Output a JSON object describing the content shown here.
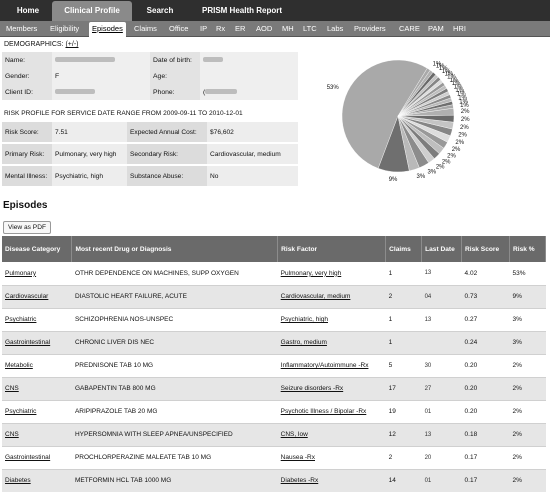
{
  "top_nav": [
    "Home",
    "Clinical Profile",
    "Search",
    "PRISM Health Report"
  ],
  "sub_nav": [
    "Members",
    "Eligibility",
    "Episodes",
    "Claims",
    "Office",
    "IP",
    "Rx",
    "ER",
    "AOD",
    "MH",
    "LTC",
    "Labs",
    "Providers",
    "CARE",
    "PAM",
    "HRI"
  ],
  "demographics": {
    "heading": "DEMOGRAPHICS:",
    "toggle": "(+/-)",
    "name_label": "Name:",
    "dob_label": "Date of birth:",
    "gender_label": "Gender:",
    "gender_value": "F",
    "age_label": "Age:",
    "client_id_label": "Client ID:",
    "phone_label": "Phone:",
    "phone_value": "("
  },
  "risk_profile": {
    "heading": "RISK PROFILE FOR SERVICE DATE RANGE FROM 2009-09-11 TO 2010-12-01",
    "risk_score_label": "Risk Score:",
    "risk_score_value": "7.51",
    "expected_cost_label": "Expected Annual Cost:",
    "expected_cost_value": "$76,602",
    "primary_label": "Primary Risk:",
    "primary_value": "Pulmonary, very high",
    "secondary_label": "Secondary Risk:",
    "secondary_value": "Cardiovascular, medium",
    "mental_label": "Mental Illness:",
    "mental_value": "Psychiatric, high",
    "substance_label": "Substance Abuse:",
    "substance_value": "No"
  },
  "chart_data": {
    "type": "pie",
    "title": "",
    "slices": [
      {
        "label": "53%",
        "value": 53
      },
      {
        "label": "9%",
        "value": 9
      },
      {
        "label": "3%",
        "value": 3
      },
      {
        "label": "3%",
        "value": 3
      },
      {
        "label": "2%",
        "value": 2
      },
      {
        "label": "2%",
        "value": 2
      },
      {
        "label": "2%",
        "value": 2
      },
      {
        "label": "2%",
        "value": 2
      },
      {
        "label": "2%",
        "value": 2
      },
      {
        "label": "2%",
        "value": 2
      },
      {
        "label": "2%",
        "value": 2
      },
      {
        "label": "2%",
        "value": 2
      },
      {
        "label": "2%",
        "value": 2
      },
      {
        "label": "1%",
        "value": 1
      },
      {
        "label": "1%",
        "value": 1
      },
      {
        "label": "1%",
        "value": 1
      },
      {
        "label": "1%",
        "value": 1
      },
      {
        "label": "1%",
        "value": 1
      },
      {
        "label": "1%",
        "value": 1
      },
      {
        "label": "1%",
        "value": 1
      },
      {
        "label": "1%",
        "value": 1
      },
      {
        "label": "1%",
        "value": 1
      },
      {
        "label": "1%",
        "value": 1
      },
      {
        "label": "1%",
        "value": 1
      },
      {
        "label": "1%",
        "value": 1
      },
      {
        "label": "1%",
        "value": 1
      },
      {
        "label": "1%",
        "value": 1
      }
    ]
  },
  "episodes": {
    "title": "Episodes",
    "pdf_button": "View as PDF",
    "columns": [
      "Disease Category",
      "Most recent Drug or Diagnosis",
      "Risk Factor",
      "Claims",
      "Last Date",
      "Risk Score",
      "Risk %"
    ],
    "rows": [
      {
        "category": "Pulmonary",
        "drug": "OTHR DEPENDENCE ON MACHINES, SUPP OXYGEN",
        "factor": "Pulmonary, very high",
        "claims": "1",
        "date": "13",
        "score": "4.02",
        "pct": "53%"
      },
      {
        "category": "Cardiovascular",
        "drug": "DIASTOLIC HEART FAILURE, ACUTE",
        "factor": "Cardiovascular, medium",
        "claims": "2",
        "date": "04",
        "score": "0.73",
        "pct": "9%"
      },
      {
        "category": "Psychiatric",
        "drug": "SCHIZOPHRENIA NOS-UNSPEC",
        "factor": "Psychiatric, high",
        "claims": "1",
        "date": "13",
        "score": "0.27",
        "pct": "3%"
      },
      {
        "category": "Gastrointestinal",
        "drug": "CHRONIC LIVER DIS NEC",
        "factor": "Gastro, medium",
        "claims": "1",
        "date": "",
        "score": "0.24",
        "pct": "3%"
      },
      {
        "category": "Metabolic",
        "drug": "PREDNISONE TAB 10 MG",
        "factor": "Inflammatory/Autoimmune -Rx",
        "claims": "5",
        "date": "30",
        "score": "0.20",
        "pct": "2%"
      },
      {
        "category": "CNS",
        "drug": "GABAPENTIN TAB 800 MG",
        "factor": "Seizure disorders -Rx",
        "claims": "17",
        "date": "27",
        "score": "0.20",
        "pct": "2%"
      },
      {
        "category": "Psychiatric",
        "drug": "ARIPIPRAZOLE TAB 20 MG",
        "factor": "Psychotic Illness / Bipolar -Rx",
        "claims": "19",
        "date": "01",
        "score": "0.20",
        "pct": "2%"
      },
      {
        "category": "CNS",
        "drug": "HYPERSOMNIA WITH SLEEP APNEA/UNSPECIFIED",
        "factor": "CNS, low",
        "claims": "12",
        "date": "13",
        "score": "0.18",
        "pct": "2%"
      },
      {
        "category": "Gastrointestinal",
        "drug": "PROCHLORPERAZINE MALEATE TAB 10 MG",
        "factor": "Nausea -Rx",
        "claims": "2",
        "date": "20",
        "score": "0.17",
        "pct": "2%"
      },
      {
        "category": "Diabetes",
        "drug": "METFORMIN HCL TAB 1000 MG",
        "factor": "Diabetes -Rx",
        "claims": "14",
        "date": "01",
        "score": "0.17",
        "pct": "2%"
      }
    ]
  }
}
